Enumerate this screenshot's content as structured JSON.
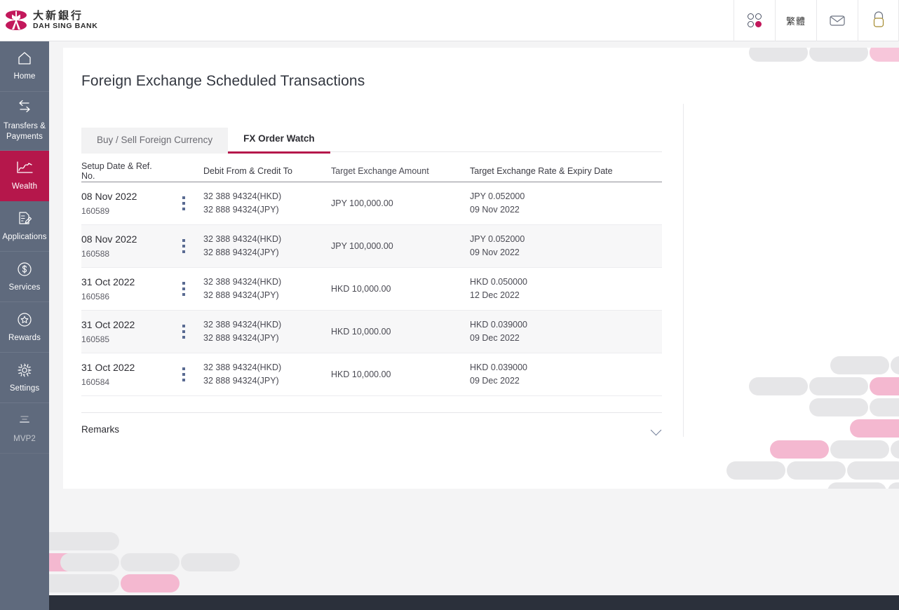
{
  "header": {
    "brand_cn": "大新銀行",
    "brand_en": "DAH SING BANK",
    "apps_icon": "apps-grid-icon",
    "language_label": "繁體",
    "mail_icon": "envelope-icon",
    "logout_icon": "lock-icon"
  },
  "sidebar": {
    "items": [
      {
        "label": "Home",
        "icon": "home-icon",
        "active": false
      },
      {
        "label": "Transfers &\nPayments",
        "icon": "transfer-arrows-icon",
        "active": false
      },
      {
        "label": "Wealth",
        "icon": "trend-chart-icon",
        "active": true
      },
      {
        "label": "Applications",
        "icon": "document-pencil-icon",
        "active": false
      },
      {
        "label": "Services",
        "icon": "dollar-circle-icon",
        "active": false
      },
      {
        "label": "Rewards",
        "icon": "star-circle-icon",
        "active": false
      },
      {
        "label": "Settings",
        "icon": "gear-icon",
        "active": false
      },
      {
        "label": "MVP2",
        "icon": "mvp-icon",
        "active": false
      }
    ]
  },
  "main": {
    "page_title": "Foreign Exchange Scheduled Transactions",
    "tabs": [
      {
        "label": "Buy / Sell Foreign Currency",
        "active": false
      },
      {
        "label": "FX Order Watch",
        "active": true
      }
    ],
    "table": {
      "columns": [
        "Setup Date & Ref. No.",
        "Debit From & Credit To",
        "Target Exchange Amount",
        "Target Exchange Rate & Expiry Date"
      ],
      "row_menu_icon": "kebab-menu-icon",
      "rows": [
        {
          "setup_date": "08 Nov 2022",
          "ref_no": "160589",
          "debit_from": "32 388 94324(HKD)",
          "credit_to": "32 888 94324(JPY)",
          "target_amount": "JPY 100,000.00",
          "target_rate": "JPY 0.052000",
          "expiry_date": "09 Nov 2022"
        },
        {
          "setup_date": "08 Nov 2022",
          "ref_no": "160588",
          "debit_from": "32 388 94324(HKD)",
          "credit_to": "32 888 94324(JPY)",
          "target_amount": "JPY 100,000.00",
          "target_rate": "JPY 0.052000",
          "expiry_date": "09 Nov 2022"
        },
        {
          "setup_date": "31 Oct 2022",
          "ref_no": "160586",
          "debit_from": "32 388 94324(HKD)",
          "credit_to": "32 888 94324(JPY)",
          "target_amount": "HKD 10,000.00",
          "target_rate": "HKD 0.050000",
          "expiry_date": "12 Dec 2022"
        },
        {
          "setup_date": "31 Oct 2022",
          "ref_no": "160585",
          "debit_from": "32 388 94324(HKD)",
          "credit_to": "32 888 94324(JPY)",
          "target_amount": "HKD 10,000.00",
          "target_rate": "HKD 0.039000",
          "expiry_date": "09 Dec 2022"
        },
        {
          "setup_date": "31 Oct 2022",
          "ref_no": "160584",
          "debit_from": "32 388 94324(HKD)",
          "credit_to": "32 888 94324(JPY)",
          "target_amount": "HKD 10,000.00",
          "target_rate": "HKD 0.039000",
          "expiry_date": "09 Dec 2022"
        }
      ]
    },
    "remarks": {
      "label": "Remarks",
      "toggle_icon": "chevron-down-icon"
    }
  },
  "colors": {
    "brand_crimson": "#b5174b",
    "logo_magenta": "#c2185b",
    "sidebar": "#5f6a7d",
    "footer": "#2b303b",
    "decor_gray": "#e6e6e8",
    "decor_pink": "#f7c6da"
  }
}
